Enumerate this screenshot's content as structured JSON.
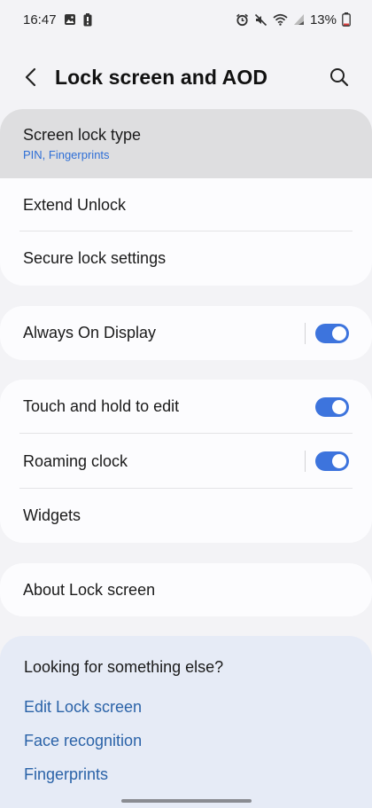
{
  "status_bar": {
    "time": "16:47",
    "battery_percent": "13%",
    "left_icons": [
      "image-icon",
      "battery-saver-icon"
    ],
    "right_icons": [
      "alarm-icon",
      "mute-icon",
      "wifi-icon",
      "signal-icon",
      "battery-icon"
    ]
  },
  "header": {
    "title": "Lock screen and AOD",
    "back_icon": "back-arrow-icon",
    "search_icon": "search-icon"
  },
  "group1": {
    "screen_lock_type": {
      "label": "Screen lock type",
      "sublabel": "PIN, Fingerprints"
    },
    "extend_unlock": {
      "label": "Extend Unlock"
    },
    "secure_lock_settings": {
      "label": "Secure lock settings"
    }
  },
  "group2": {
    "always_on_display": {
      "label": "Always On Display",
      "enabled": true
    }
  },
  "group3": {
    "touch_and_hold": {
      "label": "Touch and hold to edit",
      "enabled": true
    },
    "roaming_clock": {
      "label": "Roaming clock",
      "enabled": true
    },
    "widgets": {
      "label": "Widgets"
    }
  },
  "group4": {
    "about": {
      "label": "About Lock screen"
    }
  },
  "suggestions": {
    "title": "Looking for something else?",
    "links": [
      {
        "label": "Edit Lock screen"
      },
      {
        "label": "Face recognition"
      },
      {
        "label": "Fingerprints"
      }
    ]
  },
  "colors": {
    "background": "#f3f3f6",
    "card": "#fcfcfe",
    "highlight": "#dedee0",
    "accent_toggle": "#3d74dd",
    "link": "#2b63a8",
    "sublabel": "#2f6fd6",
    "suggestion_bg": "#e6ebf6"
  }
}
